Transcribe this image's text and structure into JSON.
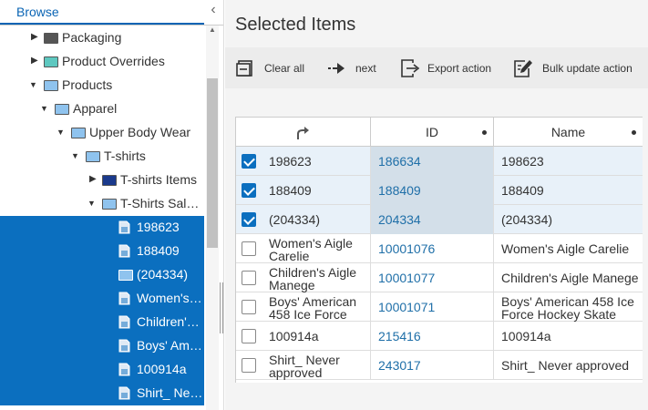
{
  "browse_tab": "Browse",
  "collapse_icon": "chevron-left-icon",
  "tree": [
    {
      "label": "Packaging",
      "expanded": false,
      "selected": false,
      "icon": "folder-icon",
      "color": "#555555"
    },
    {
      "label": "Product Overrides",
      "expanded": false,
      "selected": false,
      "icon": "folder-icon",
      "color": "#5ec8c0"
    },
    {
      "label": "Products",
      "expanded": true,
      "selected": false,
      "icon": "folder-icon",
      "color": "#8fc3ee"
    },
    {
      "label": "Apparel",
      "expanded": true,
      "selected": false,
      "icon": "folder-icon",
      "color": "#8fc3ee"
    },
    {
      "label": "Upper Body Wear",
      "expanded": true,
      "selected": false,
      "icon": "folder-icon",
      "color": "#8fc3ee"
    },
    {
      "label": "T-shirts",
      "expanded": true,
      "selected": false,
      "icon": "folder-icon",
      "color": "#8fc3ee"
    },
    {
      "label": "T-shirts Items",
      "expanded": false,
      "selected": false,
      "icon": "folder-icon",
      "color": "#1a3a8c"
    },
    {
      "label": "T-Shirts Sal…",
      "expanded": true,
      "selected": false,
      "icon": "folder-icon",
      "color": "#8fc3ee"
    },
    {
      "label": "198623",
      "selected": true,
      "icon": "document-icon"
    },
    {
      "label": "188409",
      "selected": true,
      "icon": "document-icon"
    },
    {
      "label": "(204334)",
      "selected": true,
      "icon": "folder-icon"
    },
    {
      "label": "Women's…",
      "selected": true,
      "icon": "document-icon"
    },
    {
      "label": "Children'…",
      "selected": true,
      "icon": "document-icon"
    },
    {
      "label": "Boys' Am…",
      "selected": true,
      "icon": "document-icon"
    },
    {
      "label": "100914a",
      "selected": true,
      "icon": "document-icon"
    },
    {
      "label": "Shirt_ Ne…",
      "selected": true,
      "icon": "document-icon"
    }
  ],
  "main": {
    "title": "Selected Items",
    "toolbar": {
      "clear_all": "Clear all",
      "next": "next",
      "export_action": "Export action",
      "bulk_update": "Bulk update action"
    },
    "columns": {
      "c0": "",
      "id": "ID",
      "name": "Name"
    },
    "rows": [
      {
        "checked": true,
        "c0": "198623",
        "id": "186634",
        "name": "198623"
      },
      {
        "checked": true,
        "c0": "188409",
        "id": "188409",
        "name": "188409"
      },
      {
        "checked": true,
        "c0": "(204334)",
        "id": "204334",
        "name": "(204334)"
      },
      {
        "checked": false,
        "c0": "Women's Aigle Carelie",
        "id": "10001076",
        "name": "Women's Aigle Carelie"
      },
      {
        "checked": false,
        "c0": "Children's Aigle Manege",
        "id": "10001077",
        "name": "Children's Aigle Manege"
      },
      {
        "checked": false,
        "c0": "Boys' American 458 Ice Force",
        "id": "10001071",
        "name": "Boys' American 458 Ice Force Hockey Skate"
      },
      {
        "checked": false,
        "c0": "100914a",
        "id": "215416",
        "name": "100914a"
      },
      {
        "checked": false,
        "c0": "Shirt_ Never approved",
        "id": "243017",
        "name": "Shirt_ Never approved"
      }
    ]
  },
  "colors": {
    "accent": "#0b6fbf",
    "link": "#1f6fa8"
  }
}
